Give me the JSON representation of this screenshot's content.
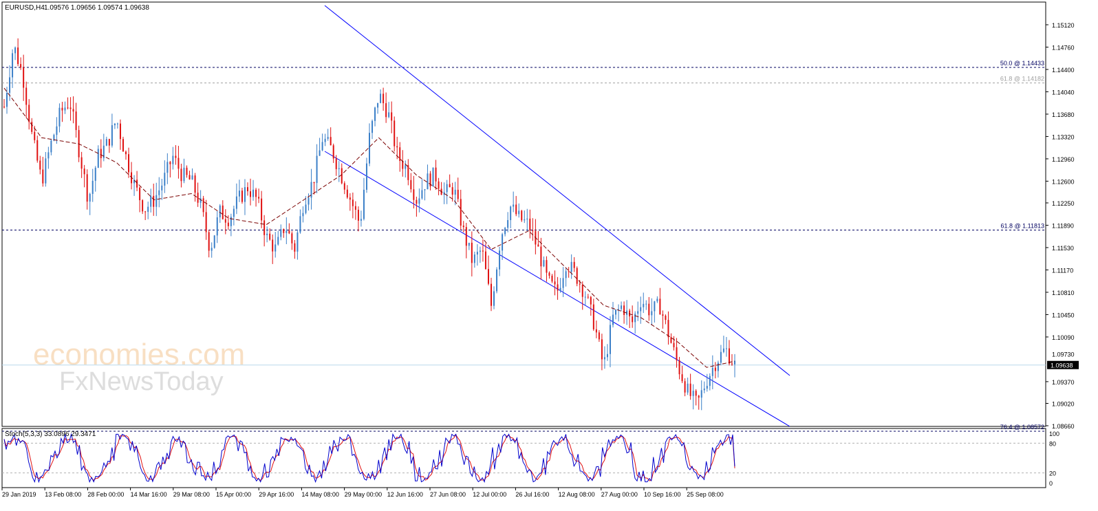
{
  "header": {
    "symbol": "EURUSD,H4",
    "ohlc": "1.09576 1.09656 1.09574 1.09638"
  },
  "watermark": {
    "line1": "economies.com",
    "line2": "FxNewsToday"
  },
  "indicator": {
    "label": "Stoch(5,3,3) 33.0896 29.3471"
  },
  "colors": {
    "bull": "#3a7fc8",
    "bear": "#e01010",
    "ma": "#7a0000",
    "channel": "#0000ff",
    "stoch_main": "#0000cc",
    "stoch_signal": "#e01010",
    "fib_line": "#000060",
    "price_line": "#b8d8ec",
    "price_tag_bg": "#000000"
  },
  "fib_levels": [
    {
      "label": "50.0 @ 1.14433",
      "value": 1.14433,
      "dark": true
    },
    {
      "label": "61.8 @ 1.14182",
      "value": 1.14182,
      "dark": false
    },
    {
      "label": "61.8 @ 1.11813",
      "value": 1.11813,
      "dark": true
    },
    {
      "label": "76.4 @ 1.08572",
      "value": 1.08572,
      "dark": true
    }
  ],
  "price_tags": [
    {
      "text": "1.09730",
      "value": 1.0973,
      "style": "plain"
    },
    {
      "text": "1.09638",
      "value": 1.09638,
      "style": "current"
    }
  ],
  "stoch_axis": [
    "100",
    "80",
    "20",
    "0"
  ],
  "chart_data": {
    "type": "candlestick",
    "timeframe": "H4",
    "ylim": [
      1.0866,
      1.1512
    ],
    "y_ticks": [
      "1.15120",
      "1.14760",
      "1.14400",
      "1.14040",
      "1.13680",
      "1.13320",
      "1.12960",
      "1.12600",
      "1.12250",
      "1.11890",
      "1.11530",
      "1.11170",
      "1.10810",
      "1.10450",
      "1.10090",
      "1.09370",
      "1.09020",
      "1.08660"
    ],
    "x_tick_labels": [
      "29 Jan 2019",
      "13 Feb 08:00",
      "28 Feb 00:00",
      "14 Mar 16:00",
      "29 Mar 08:00",
      "15 Apr 00:00",
      "29 Apr 16:00",
      "14 May 08:00",
      "29 May 00:00",
      "12 Jun 16:00",
      "27 Jun 08:00",
      "12 Jul 00:00",
      "26 Jul 16:00",
      "12 Aug 08:00",
      "27 Aug 00:00",
      "10 Sep 16:00",
      "25 Sep 08:00"
    ],
    "price_anchors": [
      [
        0,
        1.138
      ],
      [
        2,
        1.148
      ],
      [
        4,
        1.143
      ],
      [
        6,
        1.133
      ],
      [
        8,
        1.126
      ],
      [
        10,
        1.132
      ],
      [
        12,
        1.137
      ],
      [
        14,
        1.139
      ],
      [
        16,
        1.131
      ],
      [
        18,
        1.123
      ],
      [
        20,
        1.13
      ],
      [
        22,
        1.132
      ],
      [
        24,
        1.136
      ],
      [
        26,
        1.13
      ],
      [
        28,
        1.125
      ],
      [
        30,
        1.1215
      ],
      [
        32,
        1.123
      ],
      [
        34,
        1.126
      ],
      [
        36,
        1.13
      ],
      [
        38,
        1.127
      ],
      [
        40,
        1.126
      ],
      [
        42,
        1.122
      ],
      [
        44,
        1.115
      ],
      [
        46,
        1.121
      ],
      [
        48,
        1.12
      ],
      [
        50,
        1.123
      ],
      [
        52,
        1.125
      ],
      [
        54,
        1.123
      ],
      [
        56,
        1.117
      ],
      [
        58,
        1.115
      ],
      [
        60,
        1.119
      ],
      [
        62,
        1.115
      ],
      [
        64,
        1.123
      ],
      [
        66,
        1.126
      ],
      [
        68,
        1.133
      ],
      [
        70,
        1.131
      ],
      [
        72,
        1.127
      ],
      [
        74,
        1.123
      ],
      [
        76,
        1.119
      ],
      [
        78,
        1.133
      ],
      [
        80,
        1.14
      ],
      [
        82,
        1.137
      ],
      [
        84,
        1.13
      ],
      [
        86,
        1.128
      ],
      [
        88,
        1.123
      ],
      [
        90,
        1.126
      ],
      [
        92,
        1.127
      ],
      [
        94,
        1.124
      ],
      [
        96,
        1.125
      ],
      [
        98,
        1.118
      ],
      [
        100,
        1.113
      ],
      [
        102,
        1.115
      ],
      [
        104,
        1.106
      ],
      [
        106,
        1.117
      ],
      [
        108,
        1.122
      ],
      [
        110,
        1.12
      ],
      [
        112,
        1.119
      ],
      [
        114,
        1.115
      ],
      [
        116,
        1.11
      ],
      [
        118,
        1.108
      ],
      [
        120,
        1.113
      ],
      [
        122,
        1.111
      ],
      [
        124,
        1.108
      ],
      [
        126,
        1.103
      ],
      [
        128,
        1.096
      ],
      [
        130,
        1.104
      ],
      [
        132,
        1.106
      ],
      [
        134,
        1.103
      ],
      [
        136,
        1.107
      ],
      [
        138,
        1.105
      ],
      [
        140,
        1.106
      ],
      [
        142,
        1.101
      ],
      [
        144,
        1.096
      ],
      [
        146,
        1.092
      ],
      [
        148,
        1.09
      ],
      [
        150,
        1.094
      ],
      [
        152,
        1.097
      ],
      [
        154,
        1.099
      ],
      [
        156,
        1.0964
      ]
    ],
    "moving_average_anchors": [
      [
        0,
        1.141
      ],
      [
        8,
        1.133
      ],
      [
        16,
        1.132
      ],
      [
        24,
        1.129
      ],
      [
        32,
        1.123
      ],
      [
        40,
        1.124
      ],
      [
        48,
        1.12
      ],
      [
        56,
        1.119
      ],
      [
        64,
        1.123
      ],
      [
        72,
        1.127
      ],
      [
        80,
        1.133
      ],
      [
        88,
        1.127
      ],
      [
        96,
        1.123
      ],
      [
        104,
        1.115
      ],
      [
        112,
        1.118
      ],
      [
        120,
        1.112
      ],
      [
        128,
        1.106
      ],
      [
        136,
        1.104
      ],
      [
        144,
        1.1
      ],
      [
        150,
        1.096
      ],
      [
        156,
        1.097
      ]
    ],
    "channel_lines": [
      {
        "from": [
          0,
          1.1512
        ],
        "to": [
          1,
          1.0983
        ]
      },
      {
        "from": [
          0,
          1.1342
        ],
        "to": [
          1,
          1.086
        ]
      }
    ],
    "last_price": 1.09638,
    "stochastic": {
      "main": 33.0896,
      "signal": 29.3471,
      "levels": [
        80,
        20
      ],
      "range": [
        0,
        100
      ]
    }
  }
}
